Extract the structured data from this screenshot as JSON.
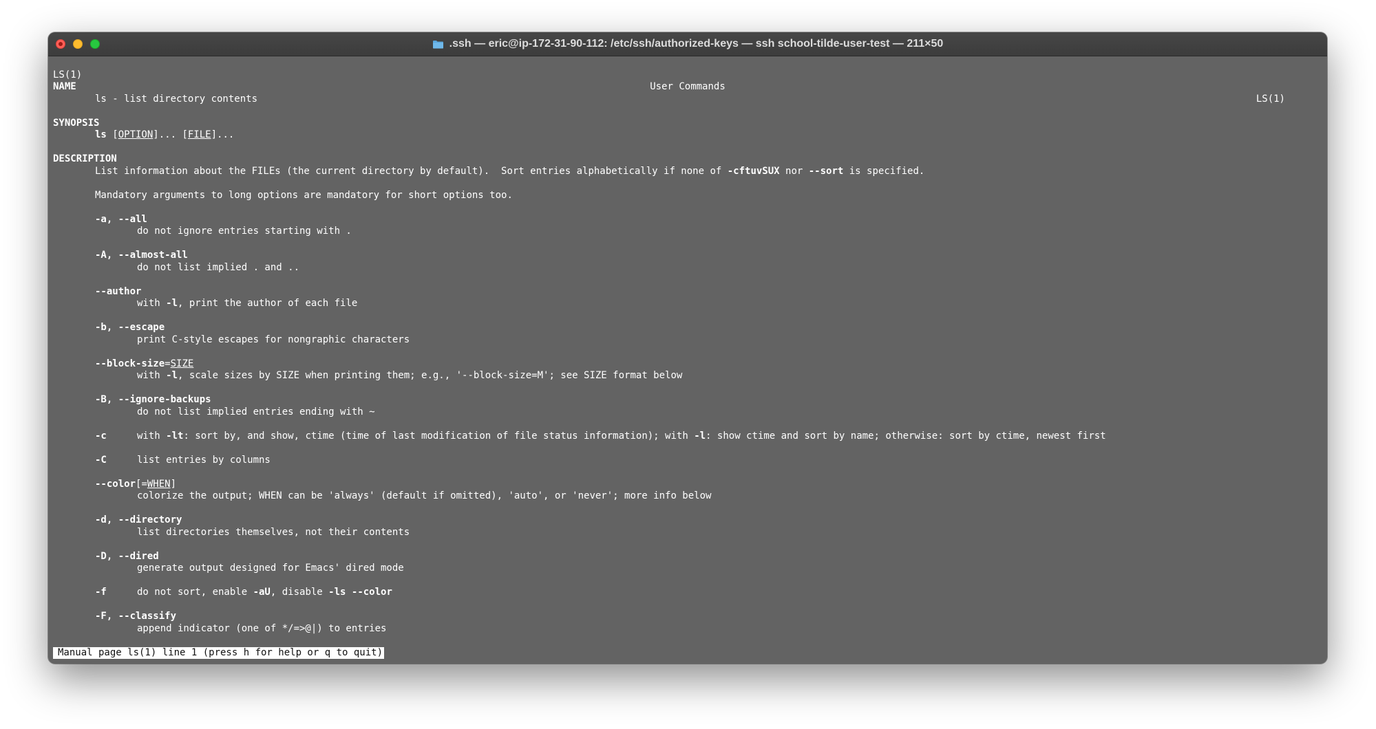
{
  "window": {
    "title": ".ssh — eric@ip-172-31-90-112: /etc/ssh/authorized-keys — ssh school-tilde-user-test — 211×50",
    "title_icon": "folder-icon"
  },
  "man": {
    "header_left": "LS(1)",
    "header_center": "User Commands",
    "header_right": "LS(1)",
    "name_heading": "NAME",
    "name_line": "ls - list directory contents",
    "synopsis_heading": "SYNOPSIS",
    "synopsis": {
      "cmd": "ls",
      "sp1": " [",
      "option": "OPTION",
      "mid": "]... [",
      "file": "FILE",
      "end": "]..."
    },
    "description_heading": "DESCRIPTION",
    "desc1": {
      "a": "List information about the FILEs (the current directory by default).  Sort entries alphabetically if none of ",
      "b": "-cftuvSUX",
      "c": " nor ",
      "d": "--sort",
      "e": " is specified."
    },
    "desc2": "Mandatory arguments to long options are mandatory for short options too.",
    "opt_all": {
      "flag": "-a, --all",
      "desc": "do not ignore entries starting with ."
    },
    "opt_almost_all": {
      "flag": "-A, --almost-all",
      "desc": "do not list implied . and .."
    },
    "opt_author": {
      "flag": "--author",
      "pre": "with ",
      "bold": "-l",
      "post": ", print the author of each file"
    },
    "opt_escape": {
      "flag": "-b, --escape",
      "desc": "print C-style escapes for nongraphic characters"
    },
    "opt_block_size": {
      "flag": "--block-size",
      "eq": "=",
      "arg": "SIZE",
      "pre": "with ",
      "bold": "-l",
      "post": ", scale sizes by SIZE when printing them; e.g., '--block-size=M'; see SIZE format below"
    },
    "opt_ignore_backups": {
      "flag": "-B, --ignore-backups",
      "desc": "do not list implied entries ending with ~"
    },
    "opt_c": {
      "flag": "-c",
      "pre": "with ",
      "b1": "-lt",
      "mid": ": sort by, and show, ctime (time of last modification of file status information); with ",
      "b2": "-l",
      "post": ": show ctime and sort by name; otherwise: sort by ctime, newest first"
    },
    "opt_C": {
      "flag": "-C",
      "desc": "list entries by columns"
    },
    "opt_color": {
      "flag": "--color",
      "open": "[=",
      "arg": "WHEN",
      "close": "]",
      "desc": "colorize the output; WHEN can be 'always' (default if omitted), 'auto', or 'never'; more info below"
    },
    "opt_directory": {
      "flag": "-d, --directory",
      "desc": "list directories themselves, not their contents"
    },
    "opt_dired": {
      "flag": "-D, --dired",
      "desc": "generate output designed for Emacs' dired mode"
    },
    "opt_f": {
      "flag": "-f",
      "pre": "do not sort, enable ",
      "b1": "-aU",
      "mid": ", disable ",
      "b2": "-ls --color",
      "post": ""
    },
    "opt_classify": {
      "flag": "-F, --classify",
      "desc": "append indicator (one of */=>@|) to entries"
    }
  },
  "status_bar": "Manual page ls(1) line 1 (press h for help or q to quit)"
}
